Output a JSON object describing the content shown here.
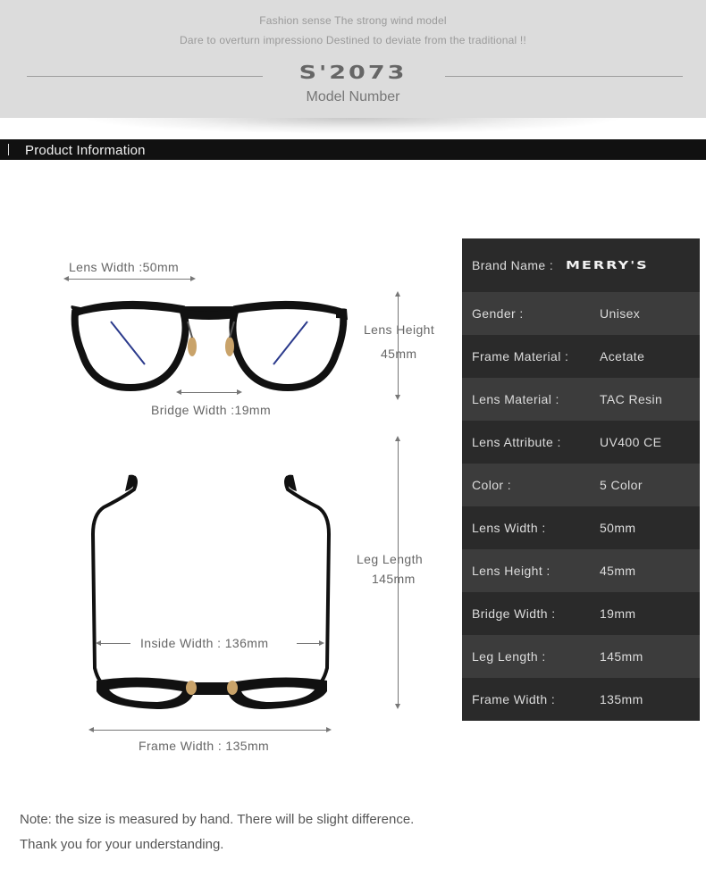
{
  "banner": {
    "tagline_1": "Fashion sense The strong wind model",
    "tagline_2": "Dare to overturn impressiono Destined to deviate from the traditional !!",
    "model_code": "S'2073",
    "model_label": "Model Number"
  },
  "section": {
    "title": "Product Information"
  },
  "diagram": {
    "lens_width": "Lens Width :50mm",
    "lens_height_label": "Lens Height",
    "lens_height_value": "45mm",
    "bridge_width": "Bridge Width :19mm",
    "leg_length_label": "Leg Length",
    "leg_length_value": "145mm",
    "inside_width": "Inside  Width : 136mm",
    "frame_width": "Frame Width : 135mm"
  },
  "specs": {
    "brand_key": "Brand Name :",
    "brand_logo": "MERRY'S",
    "rows": [
      {
        "key": "Gender :",
        "value": "Unisex"
      },
      {
        "key": "Frame Material :",
        "value": "Acetate"
      },
      {
        "key": "Lens Material :",
        "value": "TAC Resin"
      },
      {
        "key": "Lens Attribute :",
        "value": "UV400 CE"
      },
      {
        "key": "Color :",
        "value": "5 Color"
      },
      {
        "key": "Lens Width :",
        "value": "50mm"
      },
      {
        "key": "Lens Height :",
        "value": "45mm"
      },
      {
        "key": "Bridge Width :",
        "value": "19mm"
      },
      {
        "key": "Leg Length :",
        "value": "145mm"
      },
      {
        "key": "Frame Width :",
        "value": "135mm"
      }
    ]
  },
  "note": {
    "line_1": "Note: the size is measured by hand. There will be slight difference.",
    "line_2": "Thank you for your understanding."
  },
  "colors": {
    "banner_bg": "#dcdcdc",
    "section_bar": "#111111",
    "table_dark": "#2a2a2a",
    "table_light": "#3c3c3c",
    "nose_pad": "#c9a36a",
    "lens_tint": "#2b3a8c"
  }
}
